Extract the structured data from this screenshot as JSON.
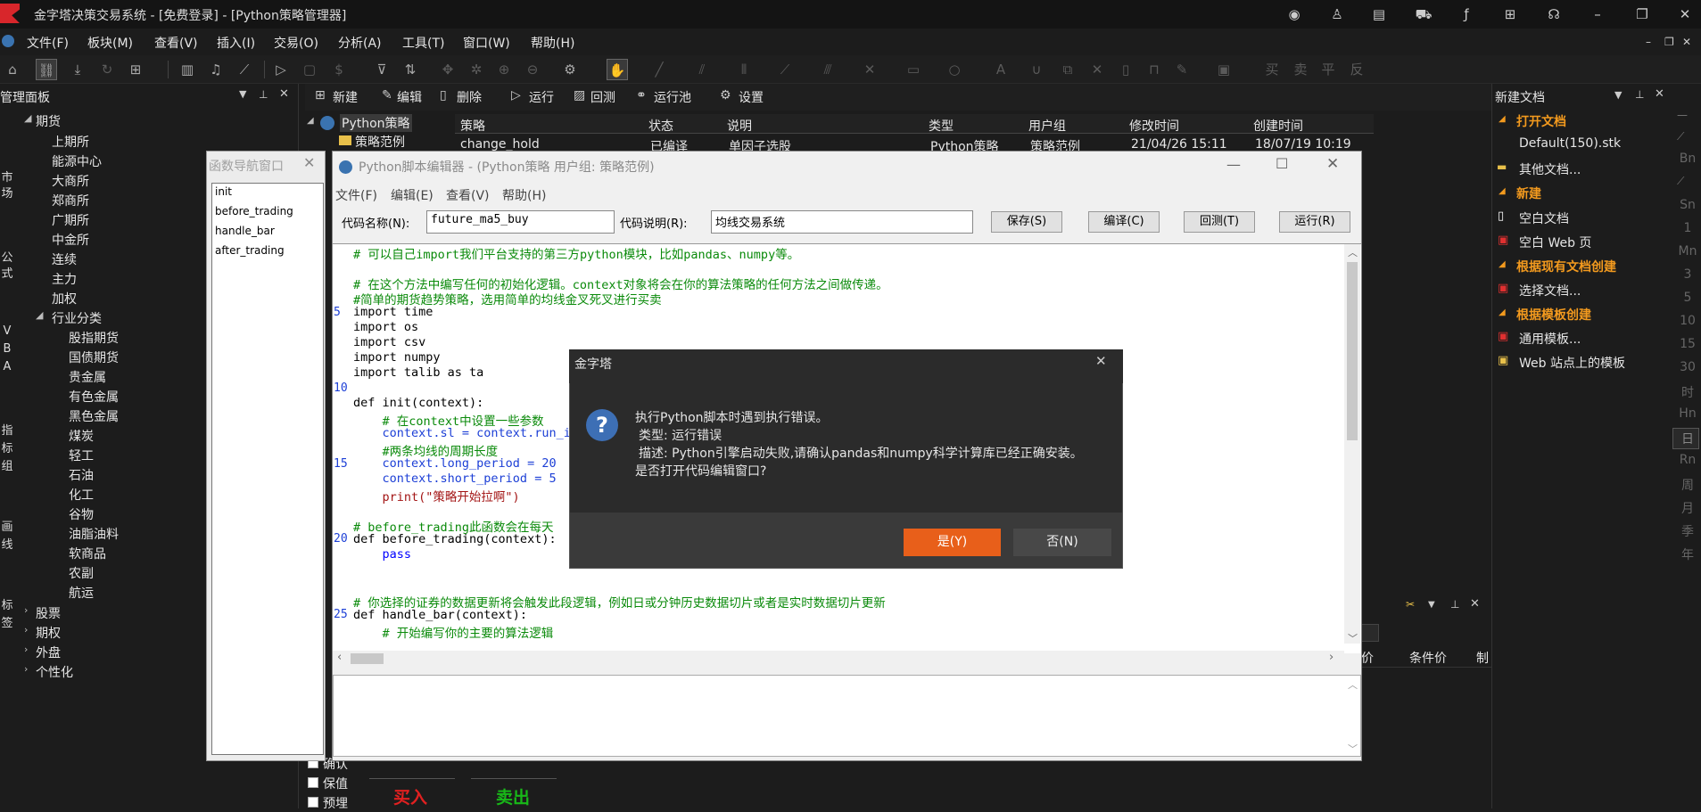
{
  "window": {
    "title": "金字塔决策交易系统 - [免费登录] - [Python策略管理器]"
  },
  "menubar": [
    "文件(F)",
    "板块(M)",
    "查看(V)",
    "插入(I)",
    "交易(O)",
    "分析(A)",
    "工具(T)",
    "窗口(W)",
    "帮助(H)"
  ],
  "toolbar2": {
    "new": "新建",
    "edit": "编辑",
    "delete": "删除",
    "run": "运行",
    "backtest": "回测",
    "runpool": "运行池",
    "settings": "设置"
  },
  "left_panel": {
    "title": "管理面板",
    "futures": "期货",
    "exchanges": [
      "上期所",
      "能源中心",
      "大商所",
      "郑商所",
      "广期所",
      "中金所",
      "连续",
      "主力",
      "加权"
    ],
    "industry": "行业分类",
    "industries": [
      "股指期货",
      "国债期货",
      "贵金属",
      "有色金属",
      "黑色金属",
      "煤炭",
      "轻工",
      "石油",
      "化工",
      "谷物",
      "油脂油料",
      "软商品",
      "农副",
      "航运"
    ],
    "others": [
      "股票",
      "期权",
      "外盘",
      "个性化"
    ],
    "strip": [
      "市",
      "场",
      "公",
      "式",
      "V",
      "B",
      "A",
      "指",
      "标",
      "组",
      "画",
      "线",
      "标",
      "签"
    ]
  },
  "strategy_tree": {
    "root": "Python策略",
    "child": "策略范例"
  },
  "strategy_table": {
    "headers": [
      "策略",
      "状态",
      "说明",
      "类型",
      "用户组",
      "修改时间",
      "创建时间"
    ],
    "row": [
      "change_hold",
      "已编译",
      "单因子选股",
      "Python策略",
      "策略范例",
      "21/04/26 15:11",
      "18/07/19 10:19"
    ]
  },
  "func_nav": {
    "title": "函数导航窗口",
    "items": [
      "init",
      "before_trading",
      "handle_bar",
      "after_trading"
    ]
  },
  "editor": {
    "title": "Python脚本编辑器 - (Python策略 用户组: 策略范例)",
    "menu": [
      "文件(F)",
      "编辑(E)",
      "查看(V)",
      "帮助(H)"
    ],
    "code_name_label": "代码名称(N):",
    "code_name": "future_ma5_buy",
    "code_desc_label": "代码说明(R):",
    "code_desc": "均线交易系统",
    "buttons": {
      "save": "保存(S)",
      "compile": "编译(C)",
      "backtest": "回测(T)",
      "run": "运行(R)"
    },
    "line_numbers": [
      "5",
      "10",
      "15",
      "20",
      "25"
    ]
  },
  "code_lines": [
    "# 可以自己import我们平台支持的第三方python模块，比如pandas、numpy等。",
    "# 在这个方法中编写任何的初始化逻辑。context对象将会在你的算法策略的任何方法之间做传递。",
    "#简单的期货趋势策略，选用简单的均线金叉死叉进行买卖",
    "import time",
    "import os",
    "import csv",
    "import numpy",
    "import talib as ta",
    "def init(context):",
    "    # 在context中设置一些参数",
    "    context.sl = context.run_i",
    "    #两条均线的周期长度",
    "    context.long_period = 20",
    "    context.short_period = 5",
    "    print(\"策略开始拉啊\")",
    "# before_trading此函数会在每天",
    "def before_trading(context):",
    "    pass",
    "# 你选择的证券的数据更新将会触发此段逻辑，例如日或分钟历史数据切片或者是实时数据切片更新",
    "def handle_bar(context):",
    "    # 开始编写你的主要的算法逻辑"
  ],
  "dialog": {
    "title": "金字塔",
    "line1": "执行Python脚本时遇到执行错误。",
    "line2": "类型: 运行错误",
    "line3": "描述: Python引擎启动失败,请确认pandas和numpy科学计算库已经正确安装。",
    "line4": "是否打开代码编辑窗口?",
    "yes": "是(Y)",
    "no": "否(N)"
  },
  "right_panel": {
    "title": "新建文档",
    "open_doc": "打开文档",
    "default_file": "Default(150).stk",
    "other_docs": "其他文档...",
    "new": "新建",
    "blank_doc": "空白文档",
    "blank_web": "空白 Web 页",
    "from_existing": "根据现有文档创建",
    "choose_doc": "选择文档...",
    "from_template": "根据模板创建",
    "generic_template": "通用模板...",
    "web_template": "Web 站点上的模板"
  },
  "right_strip": [
    "Bn",
    "Sn",
    "1",
    "Mn",
    "3",
    "5",
    "10",
    "15",
    "30",
    "时",
    "Hn",
    "日",
    "Rn",
    "周",
    "月",
    "季",
    "年"
  ],
  "order_panel": {
    "col1": "价",
    "col2": "条件价",
    "col3": "制"
  },
  "bottom": {
    "confirm": "确认",
    "hold": "保值",
    "other": "预埋",
    "buy": "买入",
    "sell": "卖出"
  },
  "colors": {
    "accent": "#e85f1a",
    "orange_text": "#f39a1e",
    "buy": "#e02020",
    "sell": "#18b818"
  }
}
